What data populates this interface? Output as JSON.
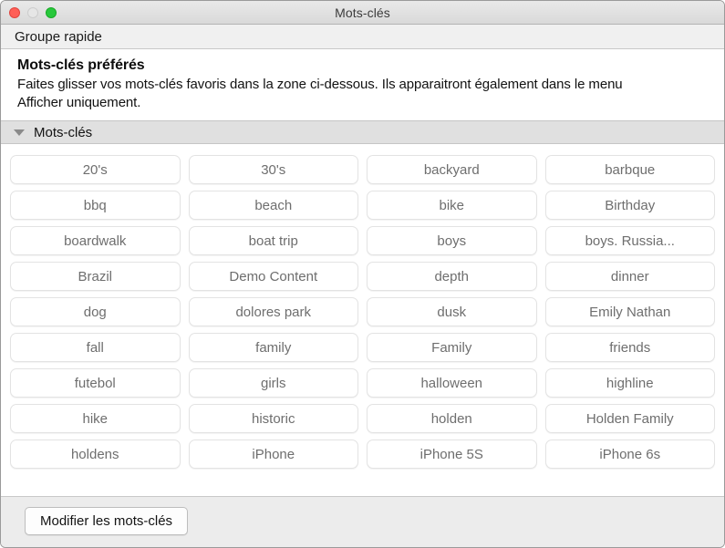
{
  "window": {
    "title": "Mots-clés",
    "controls": {
      "close": "close-button",
      "minimize": "minimize-button",
      "zoom": "zoom-button"
    }
  },
  "quick_group": {
    "label": "Groupe rapide"
  },
  "description": {
    "heading": "Mots-clés préférés",
    "body": "Faites glisser vos mots-clés favoris dans la zone ci-dessous. Ils apparaitront également dans le menu Afficher uniquement."
  },
  "section": {
    "title": "Mots-clés",
    "expanded": true,
    "disclosure_icon": "triangle-down-icon"
  },
  "keywords": [
    "20's",
    "30's",
    "backyard",
    "barbque",
    "bbq",
    "beach",
    "bike",
    "Birthday",
    "boardwalk",
    "boat trip",
    "boys",
    "boys. Russia...",
    "Brazil",
    "Demo Content",
    "depth",
    "dinner",
    "dog",
    "dolores park",
    "dusk",
    "Emily Nathan",
    "fall",
    "family",
    "Family",
    "friends",
    "futebol",
    "girls",
    "halloween",
    "highline",
    "hike",
    "historic",
    "holden",
    "Holden Family",
    "holdens",
    "iPhone",
    "iPhone 5S",
    "iPhone 6s"
  ],
  "footer": {
    "edit_label": "Modifier les mots-clés"
  },
  "colors": {
    "titlebar_top": "#e9e9e9",
    "titlebar_bottom": "#d9d9d9",
    "close_red": "#ff5f57",
    "minimize_gray": "#e6e6e6",
    "zoom_green": "#28c83c",
    "section_header_bg": "#e0e0e0",
    "footer_bg": "#ececec",
    "keyword_text": "#6e6e6e",
    "keyword_border": "#e3e3e3"
  }
}
